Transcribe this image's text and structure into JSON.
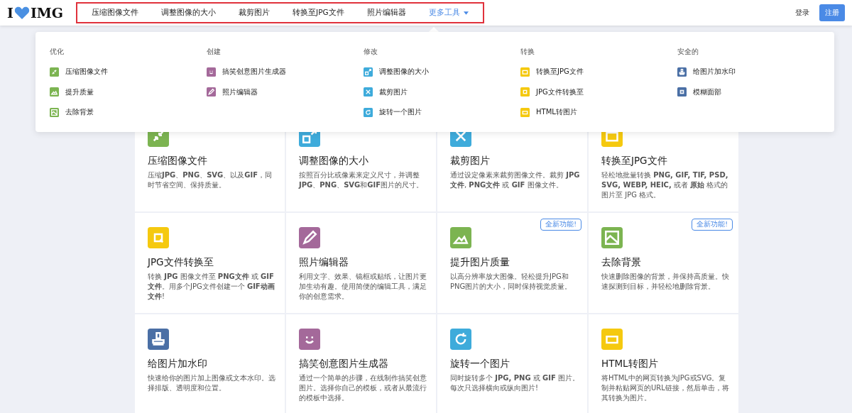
{
  "header": {
    "logo": [
      "I",
      "IMG"
    ],
    "nav": [
      {
        "label": "压缩图像文件",
        "selected": false,
        "kind": "link"
      },
      {
        "label": "调整图像的大小",
        "selected": false,
        "kind": "link"
      },
      {
        "label": "裁剪图片",
        "selected": false,
        "kind": "link"
      },
      {
        "label": "转换至JPG文件",
        "selected": false,
        "kind": "link"
      },
      {
        "label": "照片编辑器",
        "selected": false,
        "kind": "link"
      },
      {
        "label": "更多工具",
        "selected": true,
        "kind": "dropdown"
      }
    ],
    "login": "登录",
    "signup": "注册"
  },
  "menu": [
    {
      "heading": "优化",
      "items": [
        {
          "label": "压缩图像文件",
          "kind": "compress",
          "color": "#7cb451"
        },
        {
          "label": "提升质量",
          "kind": "upscale",
          "color": "#7cb451"
        },
        {
          "label": "去除背景",
          "kind": "remove-bg",
          "color": "#7cb451"
        }
      ]
    },
    {
      "heading": "创建",
      "items": [
        {
          "label": "搞笑创意图片生成器",
          "kind": "meme",
          "color": "#a4699a"
        },
        {
          "label": "照片编辑器",
          "kind": "edit",
          "color": "#a4699a"
        }
      ]
    },
    {
      "heading": "修改",
      "items": [
        {
          "label": "调整图像的大小",
          "kind": "resize",
          "color": "#3eabdb"
        },
        {
          "label": "裁剪图片",
          "kind": "crop",
          "color": "#3eabdb"
        },
        {
          "label": "旋转一个图片",
          "kind": "rotate",
          "color": "#3eabdb"
        }
      ]
    },
    {
      "heading": "转换",
      "items": [
        {
          "label": "转换至JPG文件",
          "kind": "convert-jpg",
          "color": "#f5c90f"
        },
        {
          "label": "JPG文件转换至",
          "kind": "from-jpg",
          "color": "#f5c90f"
        },
        {
          "label": "HTML转图片",
          "kind": "html",
          "color": "#f5c90f"
        }
      ]
    },
    {
      "heading": "安全的",
      "items": [
        {
          "label": "给图片加水印",
          "kind": "watermark",
          "color": "#4a6fa5"
        },
        {
          "label": "模糊面部",
          "kind": "blur",
          "color": "#4a6fa5"
        }
      ]
    }
  ],
  "cards": [
    {
      "title": "压缩图像文件",
      "text": "压缩**JPG**、**PNG**、**SVG**、以及**GIF**，同时节省空间、保持质量。",
      "kind": "compress",
      "color": "#7cb451"
    },
    {
      "title": "调整图像的大小",
      "text": "按照百分比或像素来定义尺寸，并调整**JPG**、**PNG**、**SVG**和**GIF**图片的尺寸。",
      "kind": "resize",
      "color": "#3eabdb"
    },
    {
      "title": "裁剪图片",
      "text": "通过设定像素来裁剪图像文件。裁剪 **JPG文件**, **PNG文件** 或 **GIF** 图像文件。",
      "kind": "crop",
      "color": "#3eabdb"
    },
    {
      "title": "转换至JPG文件",
      "text": "轻松地批量转换 **PNG, GIF, TIF, PSD, SVG, WEBP, HEIC,** 或者 **原始** 格式的图片至 JPG 格式。",
      "kind": "convert-jpg",
      "color": "#f5c90f"
    },
    {
      "title": "JPG文件转换至",
      "text": "转换 **JPG** 图像文件至 **PNG文件** 或 **GIF文件**。用多个JPG文件创建一个 **GIF动画文件**!",
      "kind": "from-jpg",
      "color": "#f5c90f"
    },
    {
      "title": "照片编辑器",
      "text": "利用文字、效果、镜框或贴纸，让图片更加生动有趣。使用简便的编辑工具，满足你的创意需求。",
      "kind": "edit",
      "color": "#a4699a"
    },
    {
      "title": "提升图片质量",
      "text": "以高分辨率放大图像。轻松提升JPG和PNG图片的大小，同时保持视觉质量。",
      "kind": "upscale",
      "color": "#7cb451",
      "badge": "全新功能!"
    },
    {
      "title": "去除背景",
      "text": "快速删除图像的背景，并保持高质量。快速探测到目标，并轻松地删除背景。",
      "kind": "remove-bg",
      "color": "#7cb451",
      "badge": "全新功能!"
    },
    {
      "title": "给图片加水印",
      "text": "快速给你的图片加上图像或文本水印。选择排版、透明度和位置。",
      "kind": "watermark",
      "color": "#4a6fa5"
    },
    {
      "title": "搞笑创意图片生成器",
      "text": "通过一个简单的步骤，在线制作搞笑创意图片。选择你自己的模板，或者从最流行的模板中选择。",
      "kind": "meme",
      "color": "#a4699a"
    },
    {
      "title": "旋转一个图片",
      "text": "同时旋转多个 **JPG, PNG** 或 **GIF** 图片。每次只选择横向或纵向图片!",
      "kind": "rotate",
      "color": "#3eabdb"
    },
    {
      "title": "HTML转图片",
      "text": "将HTML中的网页转换为JPG或SVG。复制并粘贴网页的URL链接，然后单击，将其转换为图片。",
      "kind": "html",
      "color": "#f5c90f"
    }
  ]
}
